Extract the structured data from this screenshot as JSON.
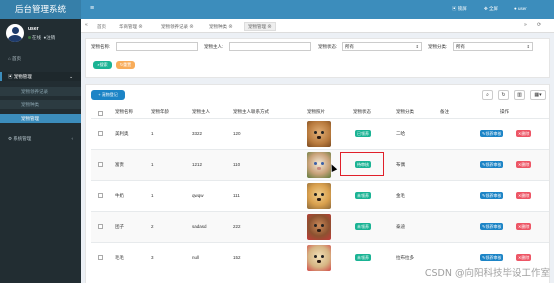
{
  "app": {
    "title": "后台管理系统"
  },
  "user": {
    "name": "user",
    "online": "在线",
    "logout": "注销"
  },
  "sidebar": {
    "home": "首页",
    "pet_mgmt": "宠物管理",
    "sub_items": [
      "宠物领养记录",
      "宠物种类",
      "宠物管理"
    ],
    "system": "系统管理"
  },
  "topbar": {
    "lock": "锁屏",
    "fullscreen": "全屏",
    "user": "user"
  },
  "tabs": {
    "home": "首页",
    "items": [
      "华商管理",
      "宠物领养记录",
      "宠物种类",
      "宠物管理"
    ]
  },
  "search": {
    "name_label": "宠物名称:",
    "owner_label": "宠物主人:",
    "status_label": "宠物状态:",
    "status_value": "所有",
    "category_label": "宠物分类:",
    "category_value": "所有",
    "search_btn": "搜索",
    "reset_btn": "重置"
  },
  "toolbar": {
    "add_btn": "宠物登记"
  },
  "table": {
    "headers": [
      "宠物名称",
      "宠物年龄",
      "宠物主人",
      "宠物主人联系方式",
      "宠物照片",
      "宠物状态",
      "宠物分类",
      "备注",
      "操作"
    ],
    "rows": [
      {
        "name": "美利奥",
        "age": "1",
        "owner": "3322",
        "phone": "120",
        "status": "已领养",
        "category": "二哈",
        "note": ""
      },
      {
        "name": "富贵",
        "age": "1",
        "owner": "1212",
        "phone": "110",
        "status": "待审核",
        "category": "布偶",
        "note": ""
      },
      {
        "name": "牛奶",
        "age": "1",
        "owner": "qwqw",
        "phone": "111",
        "status": "未领养",
        "category": "金毛",
        "note": ""
      },
      {
        "name": "团子",
        "age": "2",
        "owner": "sadasd",
        "phone": "222",
        "status": "未领养",
        "category": "泰迪",
        "note": ""
      },
      {
        "name": "毛毛",
        "age": "3",
        "owner": "null",
        "phone": "152",
        "status": "未领养",
        "category": "拉布拉多",
        "note": ""
      }
    ],
    "edit_label": "领养审核",
    "delete_label": "删除"
  },
  "watermark": "CSDN @向阳科技毕设工作室",
  "colors": {
    "sidebar": "#222d32",
    "topbar": "#3c8dbc",
    "success": "#1ab394",
    "danger": "#ed5565",
    "primary": "#1c84c6"
  }
}
